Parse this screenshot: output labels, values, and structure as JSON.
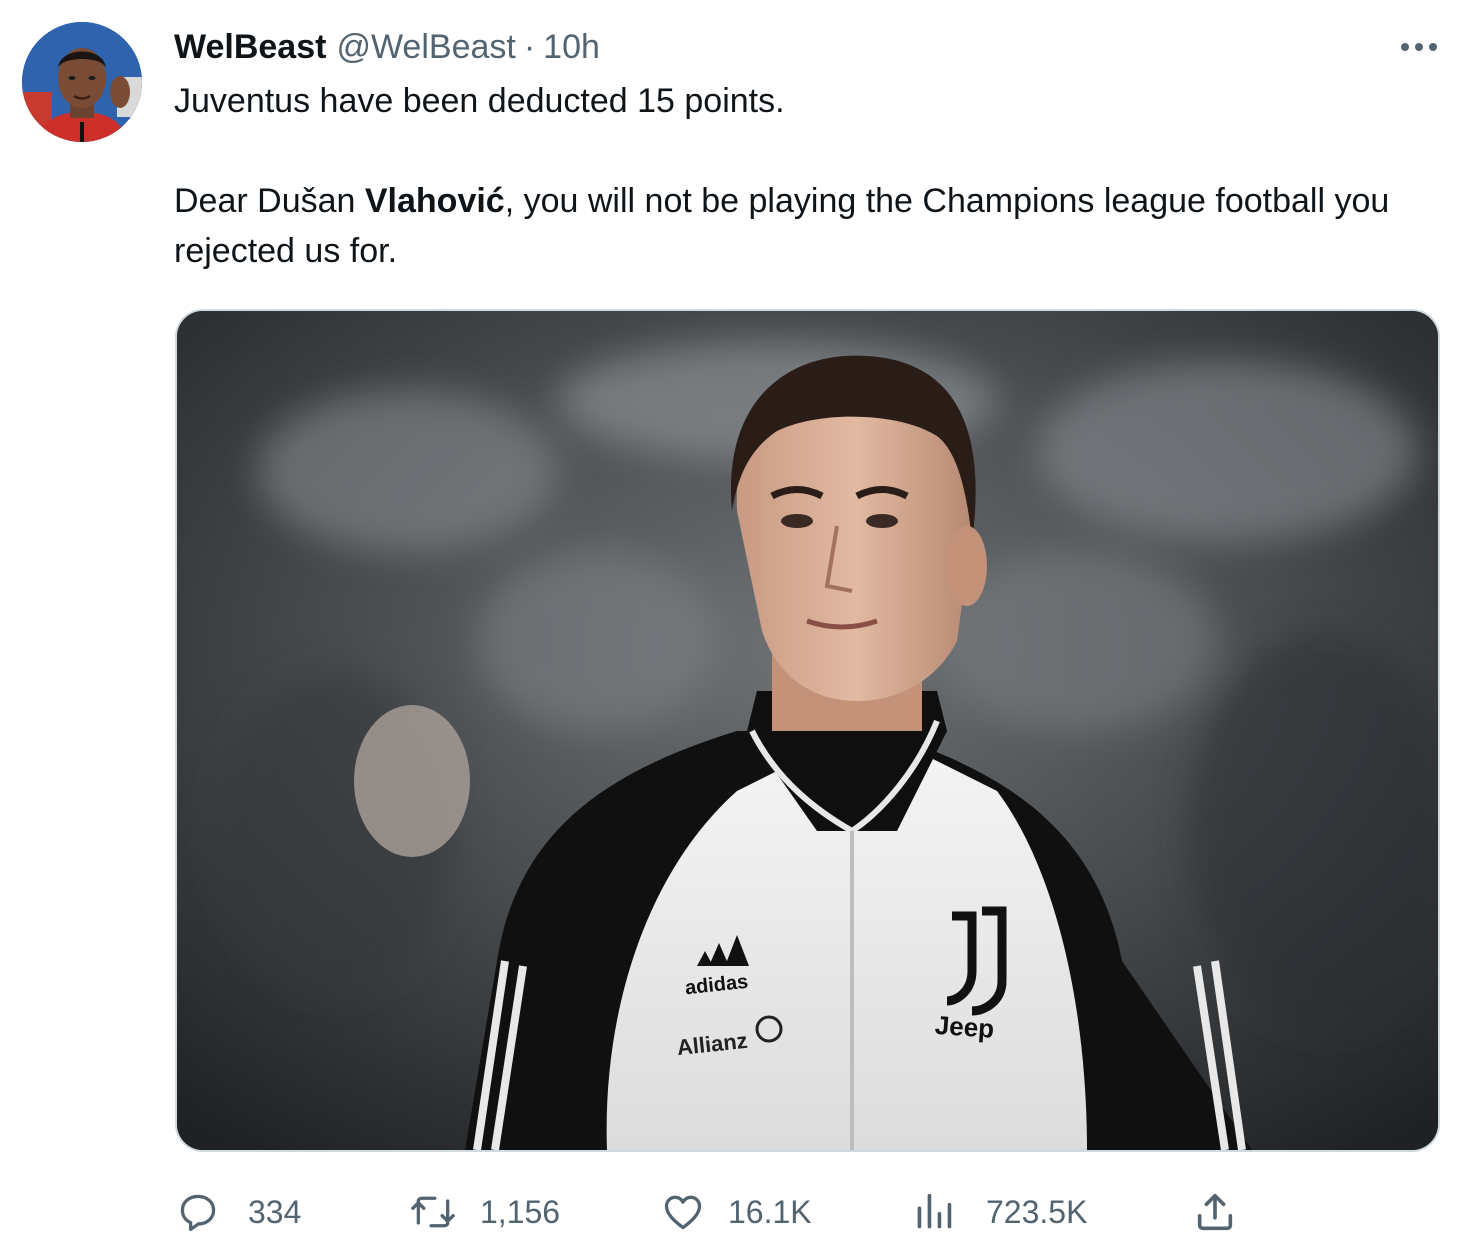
{
  "tweet": {
    "author": {
      "display_name": "WelBeast",
      "handle": "@WelBeast"
    },
    "separator": "·",
    "time": "10h",
    "text": {
      "line1": "Juventus have been deducted 15 points.",
      "para2_before": "Dear Dušan ",
      "para2_bold": "Vlahović",
      "para2_after": ", you will not be playing the Champions league football you rejected us for."
    },
    "media": {
      "jacket_brand_left": "adidas",
      "jacket_sponsor": "Allianz",
      "jacket_sponsor_main": "Jeep"
    },
    "actions": {
      "replies": "334",
      "retweets": "1,156",
      "likes": "16.1K",
      "views": "723.5K"
    },
    "icons": {
      "more": "more-horizontal-icon",
      "reply": "reply-bubble-icon",
      "retweet": "retweet-icon",
      "like": "heart-icon",
      "views": "analytics-bars-icon",
      "share": "share-upload-icon"
    },
    "colors": {
      "text_primary": "#0f1419",
      "text_secondary": "#536471",
      "border": "#cfd9de"
    }
  }
}
